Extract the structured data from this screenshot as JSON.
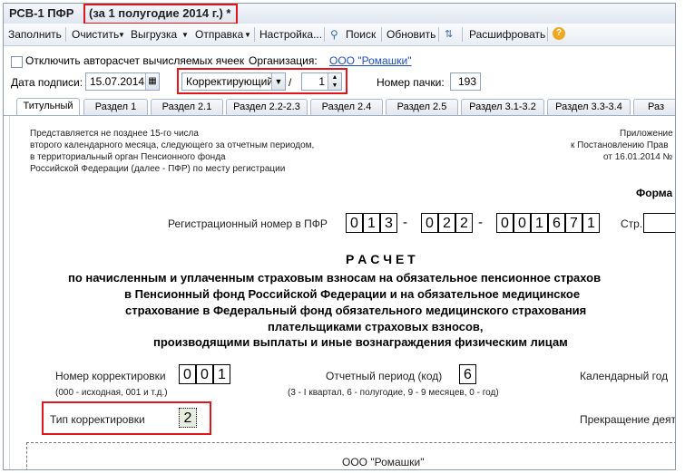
{
  "window": {
    "title_main": "РСВ-1 ПФР",
    "title_period": "(за 1 полугодие 2014 г.) *"
  },
  "toolbar": {
    "items": [
      "Заполнить",
      "Очистить",
      "Выгрузка",
      "Отправка",
      "Настройка...",
      "Поиск",
      "Обновить",
      "Расшифровать"
    ],
    "help": "?"
  },
  "options": {
    "autocalc_label": "Отключить авторасчет вычисляемых ячеек",
    "org_label": "Организация:",
    "org_value": "ООО \"Ромашки\"",
    "sign_date_label": "Дата подписи:",
    "sign_date_value": "15.07.2014",
    "corr_type_value": "Корректирующий",
    "corr_sep": "/",
    "corr_number_value": "1",
    "pack_label": "Номер пачки:",
    "pack_value": "193"
  },
  "tabs": [
    "Титульный",
    "Раздел 1",
    "Раздел 2.1",
    "Раздел 2.2-2.3",
    "Раздел 2.4",
    "Раздел 2.5",
    "Раздел 3.1-3.2",
    "Раздел 3.3-3.4",
    "Раз"
  ],
  "document": {
    "note_lines": [
      "Представляется не позднее 15-го числа",
      "второго календарного месяца, следующего за отчетным периодом,",
      "в территориальный орган Пенсионного фонда",
      "Российской Федерации (далее - ПФР) по месту регистрации"
    ],
    "appendix_lines": [
      "Приложение №",
      "к Постановлению Прав",
      "от 16.01.2014 №"
    ],
    "form_label": "Форма",
    "reg_label": "Регистрационный номер в ПФР",
    "reg_digits": [
      "0",
      "1",
      "3",
      "-",
      "0",
      "2",
      "2",
      "-",
      "0",
      "0",
      "1",
      "6",
      "7",
      "1"
    ],
    "page_label": "Стр.",
    "title": "Р А С Ч Е Т",
    "title_lines": [
      "по начисленным и уплаченным страховым взносам на обязательное пенсионное страхов",
      "в Пенсионный фонд Российской Федерации и на обязательное медицинское",
      "страхование в Федеральный фонд обязательного медицинского страхования",
      "плательщиками страховых взносов,",
      "производящими выплаты и иные вознаграждения физическим лицам"
    ],
    "corr_num_label": "Номер корректировки",
    "corr_num_digits": [
      "0",
      "0",
      "1"
    ],
    "corr_num_hint": "(000 - исходная, 001 и т.д.)",
    "period_label": "Отчетный период (код)",
    "period_value": "6",
    "period_hint": "(3 - I квартал, 6 - полугодие, 9 - 9 месяцев, 0 - год)",
    "year_label": "Календарный год",
    "corr_type_label": "Тип корректировки",
    "corr_type_value": "2",
    "termination_label": "Прекращение деят",
    "org_name": "ООО \"Ромашки\""
  }
}
